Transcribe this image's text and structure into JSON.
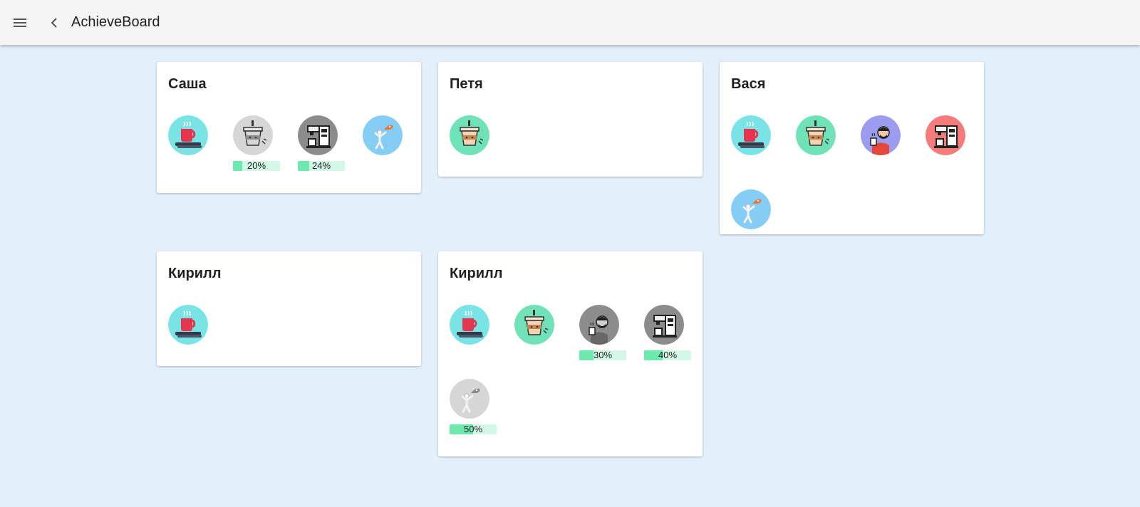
{
  "app": {
    "title": "AchieveBoard"
  },
  "colors": {
    "teal": "#7ae3e6",
    "mint": "#6fe2b8",
    "purple": "#9b9bf0",
    "red": "#f57a7a",
    "sky": "#86cdf6",
    "grey_light": "#d6d6d6",
    "grey_dark": "#8c8c8c",
    "progress_fill": "#6de9ae",
    "progress_track": "#d2f7e6"
  },
  "cards": [
    {
      "name": "Саша",
      "achievements": [
        {
          "icon": "tea-books-icon",
          "locked": false
        },
        {
          "icon": "coffee-cup-icon",
          "locked": true,
          "progress": 0.2,
          "progress_label": "20%"
        },
        {
          "icon": "coffee-machine-icon",
          "locked": true,
          "progress": 0.24,
          "progress_label": "24%"
        },
        {
          "icon": "sausage-stickman-icon",
          "locked": false
        }
      ]
    },
    {
      "name": "Петя",
      "achievements": [
        {
          "icon": "coffee-cup-icon",
          "locked": false
        }
      ]
    },
    {
      "name": "Вася",
      "achievements": [
        {
          "icon": "tea-books-icon",
          "locked": false
        },
        {
          "icon": "coffee-cup-icon",
          "locked": false
        },
        {
          "icon": "barista-icon",
          "locked": false
        },
        {
          "icon": "coffee-machine-icon",
          "locked": false
        },
        {
          "icon": "sausage-stickman-icon",
          "locked": false
        }
      ]
    },
    {
      "name": "Кирилл",
      "achievements": [
        {
          "icon": "tea-books-icon",
          "locked": false
        }
      ]
    },
    {
      "name": "Кирилл",
      "achievements": [
        {
          "icon": "tea-books-icon",
          "locked": false
        },
        {
          "icon": "coffee-cup-icon",
          "locked": false
        },
        {
          "icon": "barista-icon",
          "locked": true,
          "progress": 0.3,
          "progress_label": "30%"
        },
        {
          "icon": "coffee-machine-icon",
          "locked": true,
          "progress": 0.4,
          "progress_label": "40%"
        },
        {
          "icon": "sausage-stickman-icon",
          "locked": true,
          "progress": 0.5,
          "progress_label": "50%"
        }
      ]
    }
  ]
}
